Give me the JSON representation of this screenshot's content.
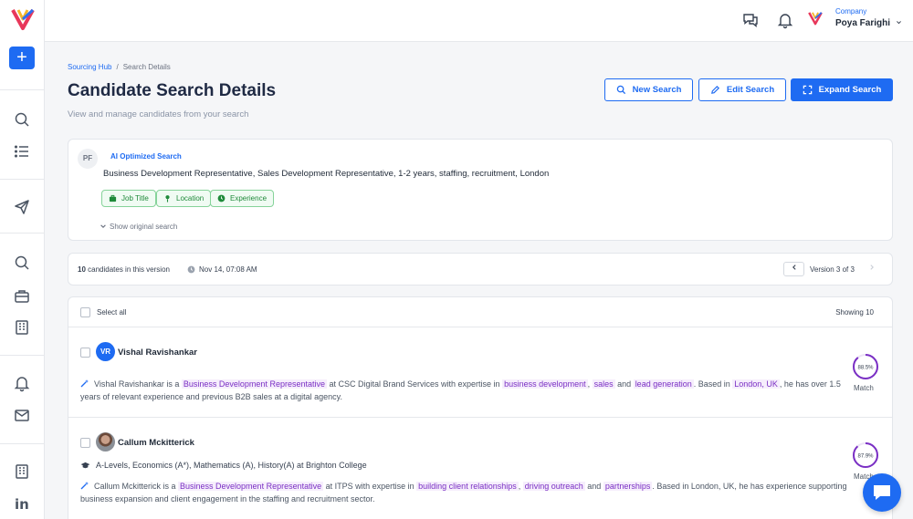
{
  "sidebar": {
    "add_label": "+",
    "linkedin_label": "in"
  },
  "topbar": {
    "company_label": "Company",
    "company_name": "Poya Farighi"
  },
  "breadcrumb": {
    "parent": "Sourcing Hub",
    "separator": "/",
    "current": "Search Details"
  },
  "header": {
    "title": "Candidate Search Details",
    "subtitle": "View and manage candidates from your search",
    "new_search": "New Search",
    "edit_search": "Edit Search",
    "expand_search": "Expand Search"
  },
  "search": {
    "avatar_initials": "PF",
    "type_label": "AI Optimized Search",
    "query": "Business Development Representative, Sales Development Representative, 1-2 years, staffing, recruitment, London",
    "chips": [
      "Job Title",
      "Location",
      "Experience"
    ],
    "show_original": "Show original search"
  },
  "version_bar": {
    "count": "10",
    "count_suffix": "candidates in this version",
    "timestamp": "Nov 14, 07:08 AM",
    "version_label": "Version 3 of 3"
  },
  "results": {
    "select_all": "Select all",
    "showing": "Showing 10",
    "candidates": [
      {
        "initials": "VR",
        "name": "Vishal Ravishankar",
        "summary": [
          {
            "t": "Vishal Ravishankar is a "
          },
          {
            "t": "Business Development Representative",
            "hl": true
          },
          {
            "t": " at CSC Digital Brand Services with expertise in "
          },
          {
            "t": "business development",
            "hl": true
          },
          {
            "t": ", "
          },
          {
            "t": "sales",
            "hl": true
          },
          {
            "t": " and "
          },
          {
            "t": "lead generation",
            "hl": true
          },
          {
            "t": ". Based in "
          },
          {
            "t": "London, UK",
            "hl": true
          },
          {
            "t": ", he has over 1.5 years of relevant experience and previous B2B sales at a digital agency."
          }
        ],
        "match_pct": "88.5%",
        "match_value": 88.5,
        "match_label": "Match"
      },
      {
        "name": "Callum Mckitterick",
        "education": "A-Levels, Economics (A*), Mathematics (A), History(A) at Brighton College",
        "summary": [
          {
            "t": "Callum Mckitterick is a "
          },
          {
            "t": "Business Development Representative",
            "hl": true
          },
          {
            "t": " at ITPS with expertise in "
          },
          {
            "t": "building client relationships",
            "hl": true
          },
          {
            "t": ", "
          },
          {
            "t": "driving outreach",
            "hl": true
          },
          {
            "t": " and "
          },
          {
            "t": "partnerships",
            "hl": true
          },
          {
            "t": ". Based in London, UK, he has experience supporting business expansion and client engagement in the staffing and recruitment sector."
          }
        ],
        "match_pct": "87.9%",
        "match_value": 87.9,
        "match_label": "Match"
      }
    ]
  },
  "colors": {
    "accent": "#1e6bf2",
    "match_ring": "#7a2fc4",
    "highlight_text": "#7a2fc4",
    "chip_green": "#1f8a3a"
  }
}
